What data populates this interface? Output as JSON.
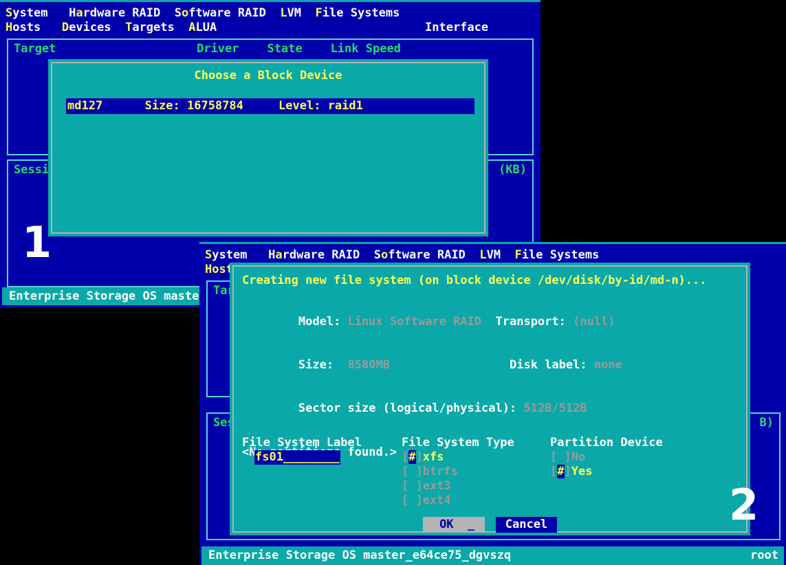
{
  "window1": {
    "menu_row1": [
      {
        "pre": "",
        "hotkey": "S",
        "post": "ystem"
      },
      {
        "pre": "H",
        "hotkey": "a",
        "post": "rdware RAID"
      },
      {
        "pre": "S",
        "hotkey": "o",
        "post": "ftware RAID"
      },
      {
        "pre": "",
        "hotkey": "L",
        "post": "VM"
      },
      {
        "pre": "",
        "hotkey": "F",
        "post": "ile Systems"
      }
    ],
    "menu_row2": [
      {
        "pre": "",
        "hotkey": "H",
        "post": "osts"
      },
      {
        "pre": "",
        "hotkey": "D",
        "post": "evices"
      },
      {
        "pre": "",
        "hotkey": "T",
        "post": "argets"
      },
      {
        "pre": "",
        "hotkey": "A",
        "post": "LUA"
      }
    ],
    "menu_right": "Interface",
    "panel_targets_header": "Target                    Driver    State    Link Speed",
    "panel_sessions_header": "Sessi",
    "panel_sessions_right": "(KB)",
    "statusbar_left": "Enterprise Storage OS master_e64ce75_dgvszq",
    "statusbar_right": "root"
  },
  "dialog1": {
    "title": "Choose a Block Device",
    "rows": [
      {
        "name": "md127",
        "size_label": "Size:",
        "size": "16758784",
        "level_label": "Level:",
        "level": "raid1",
        "selected": true
      }
    ],
    "selected_row_text": "md127      Size: 16758784     Level: raid1"
  },
  "window2": {
    "menu_row1": [
      {
        "pre": "",
        "hotkey": "S",
        "post": "ystem"
      },
      {
        "pre": "H",
        "hotkey": "a",
        "post": "rdware RAID"
      },
      {
        "pre": "S",
        "hotkey": "o",
        "post": "ftware RAID"
      },
      {
        "pre": "",
        "hotkey": "L",
        "post": "VM"
      },
      {
        "pre": "",
        "hotkey": "F",
        "post": "ile Systems"
      }
    ],
    "menu_row2_visible": "Host",
    "panel_targets_header": "Tar",
    "panel_sessions_header": "Ses",
    "panel_sessions_right": "B)",
    "statusbar_left": "Enterprise Storage OS master_e64ce75_dgvszq",
    "statusbar_right": "root"
  },
  "dialog2": {
    "title": "Creating new file system (on block device /dev/disk/by-id/md-n)...",
    "info": [
      {
        "label": "Model:",
        "value": "Linux Software RAID",
        "label2": "Transport:",
        "value2": "(null)"
      },
      {
        "label": "Size:",
        "value": "8580MB",
        "label2": "Disk label:",
        "value2": "none"
      },
      {
        "label": "Sector size (logical/physical):",
        "value": "512B/512B",
        "label2": "",
        "value2": ""
      }
    ],
    "partitions_text": "<No partitions found.>",
    "fields": {
      "label_heading": "File System Label",
      "label_value": "fs01",
      "label_placeholder_fill": "________",
      "type_heading": "File System Type",
      "type_options": [
        {
          "text": "xfs",
          "selected": true
        },
        {
          "text": "btrfs",
          "selected": false
        },
        {
          "text": "ext3",
          "selected": false
        },
        {
          "text": "ext4",
          "selected": false
        }
      ],
      "partition_heading": "Partition Device",
      "partition_options": [
        {
          "text": "No",
          "selected": false
        },
        {
          "text": "Yes",
          "selected": true
        }
      ]
    },
    "buttons": [
      {
        "label": "OK",
        "focused": true
      },
      {
        "label": "Cancel",
        "focused": false
      }
    ]
  },
  "annotations": [
    {
      "text": "1"
    },
    {
      "text": "2"
    }
  ],
  "colors": {
    "background": "#000000",
    "window_blue": "#0000aa",
    "dialog_teal": "#0aa8a8",
    "accent_yellow": "#ffff55",
    "panel_border": "#55d7d7",
    "dialog_border": "#b3b3b3",
    "value_gray": "#9a9a9a",
    "header_green": "#22dd66"
  }
}
